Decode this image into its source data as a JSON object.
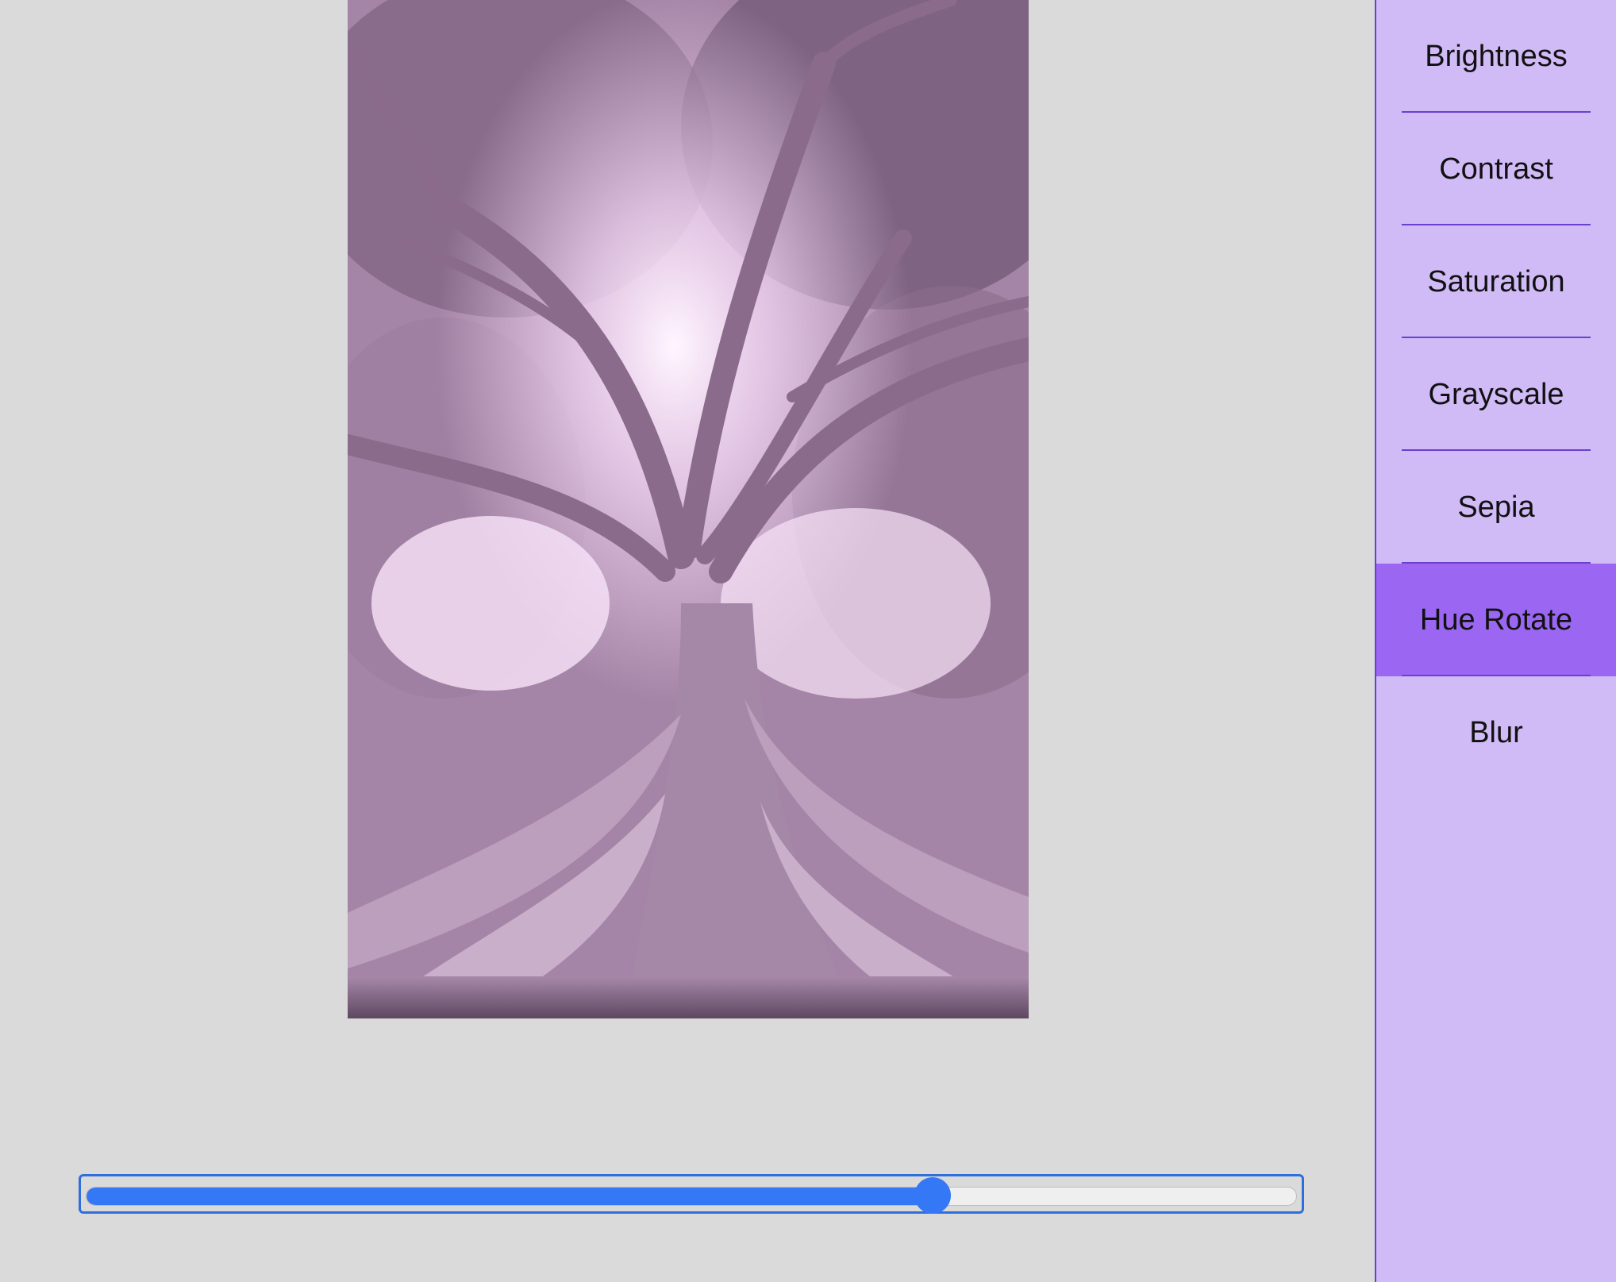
{
  "editor": {
    "image_alt": "Large tree with spreading roots and sunlit canopy",
    "slider": {
      "value": 70,
      "min": 0,
      "max": 100,
      "accent_color": "#3478f6"
    }
  },
  "sidebar": {
    "accent_color": "#9b66f2",
    "background_color": "#d0bbf7",
    "items": [
      {
        "label": "Brightness",
        "active": false
      },
      {
        "label": "Contrast",
        "active": false
      },
      {
        "label": "Saturation",
        "active": false
      },
      {
        "label": "Grayscale",
        "active": false
      },
      {
        "label": "Sepia",
        "active": false
      },
      {
        "label": "Hue Rotate",
        "active": true
      },
      {
        "label": "Blur",
        "active": false
      }
    ]
  }
}
